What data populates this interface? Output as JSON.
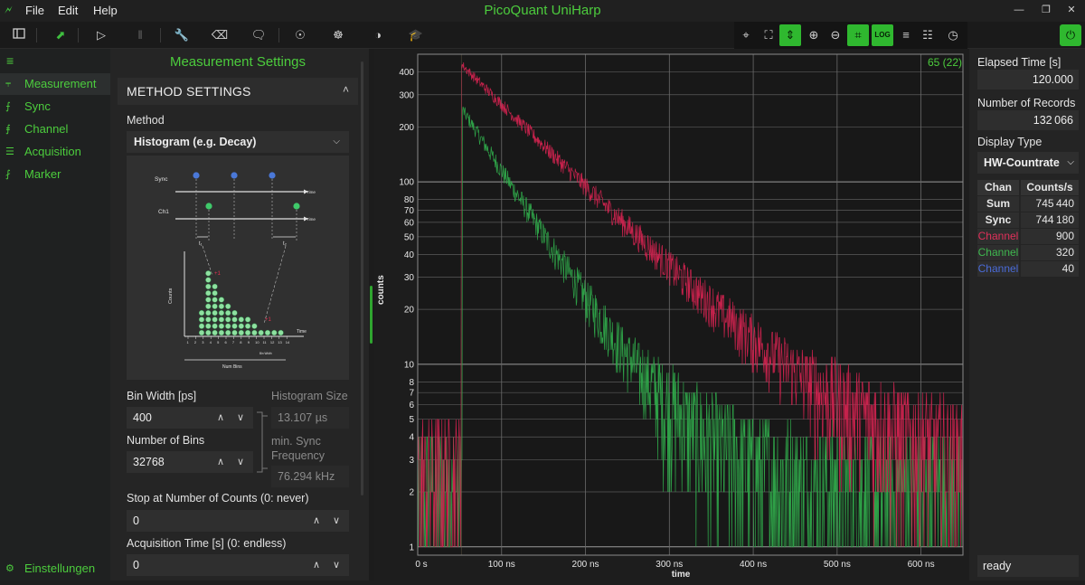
{
  "app": {
    "title": "PicoQuant UniHarp",
    "menu": [
      "File",
      "Edit",
      "Help"
    ],
    "window_controls": [
      "minimize-icon",
      "restore-icon",
      "close-icon"
    ]
  },
  "toolbar": {
    "left_icons": [
      "sidebar-toggle-icon",
      "connect-icon",
      "play-icon",
      "pause-icon",
      "wrench-icon",
      "eraser-icon",
      "comment-icon",
      "bulb-icon",
      "bug-icon",
      "contrast-icon",
      "graduation-cap-icon"
    ],
    "right_icons": [
      "crosshair-icon",
      "fit-icon",
      "fit-height-icon",
      "zoom-in-icon",
      "zoom-out-icon",
      "crop-icon",
      "log-icon",
      "notes-icon",
      "clipboard-icon",
      "book-icon",
      "speedometer-icon"
    ],
    "log_label": "LOG",
    "accent": "#2fb82f"
  },
  "sidebar": {
    "items": [
      {
        "label": "Measurement",
        "icon": "decay-icon",
        "selected": true
      },
      {
        "label": "Sync",
        "icon": "sync-icon"
      },
      {
        "label": "Channel",
        "icon": "channel-icon"
      },
      {
        "label": "Acquisition",
        "icon": "acquisition-icon"
      },
      {
        "label": "Marker",
        "icon": "marker-icon"
      }
    ],
    "footer": "Einstellungen"
  },
  "settings": {
    "title": "Measurement Settings",
    "section": "METHOD SETTINGS",
    "method_label": "Method",
    "method_value": "Histogram (e.g. Decay)",
    "diagram": {
      "sync": "Sync",
      "ch1": "Ch1",
      "time": "Time",
      "t1": "t₁",
      "t2": "t₂",
      "counts": "Counts",
      "plus_one": "+1",
      "num_bins": "Num Bins",
      "bin_width": "Bin Width",
      "ticks": [
        "1",
        "2",
        "3",
        "4",
        "5",
        "6",
        "7",
        "8",
        "9",
        "10",
        "11",
        "12",
        "13",
        "14"
      ]
    },
    "bin_width_label": "Bin Width [ps]",
    "bin_width_value": "400",
    "histogram_size_label": "Histogram Size",
    "histogram_size_value": "13.107 µs",
    "num_bins_label": "Number of Bins",
    "num_bins_value": "32768",
    "min_sync_label": "min. Sync Frequency",
    "min_sync_value": "76.294 kHz",
    "stop_label": "Stop at Number of Counts (0: never)",
    "stop_value": "0",
    "acq_label": "Acquisition Time [s] (0: endless)",
    "acq_value": "0"
  },
  "chart_data": {
    "type": "line",
    "title": "",
    "xlabel": "time",
    "ylabel": "counts",
    "y_scale": "log",
    "xlim_ns": [
      0,
      650
    ],
    "ylim": [
      0.9,
      500
    ],
    "x_ticks": [
      "0 s",
      "100 ns",
      "200 ns",
      "300 ns",
      "400 ns",
      "500 ns",
      "600 ns"
    ],
    "y_ticks": [
      "1",
      "2",
      "3",
      "4",
      "5",
      "6",
      "7",
      "8",
      "10",
      "20",
      "30",
      "40",
      "50",
      "60",
      "70",
      "80",
      "100",
      "200",
      "300",
      "400"
    ],
    "corner_label": "65 (22)",
    "grid": true,
    "series": [
      {
        "color": "#d0234f",
        "background_level": 2.5,
        "peak_time_ns": 52,
        "peak_counts": 440,
        "decay_tau_ns": 95,
        "points_t_ns": [
          52,
          100,
          150,
          200,
          250,
          300,
          350,
          400,
          450,
          500,
          600,
          650
        ],
        "points_counts": [
          420,
          200,
          110,
          60,
          35,
          20,
          13,
          8,
          6,
          5,
          4,
          3.5
        ]
      },
      {
        "color": "#2fa84a",
        "background_level": 2.0,
        "peak_time_ns": 53,
        "peak_counts": 250,
        "decay_tau_ns": 60,
        "points_t_ns": [
          53,
          100,
          150,
          200,
          250,
          300,
          350,
          400,
          500,
          650
        ],
        "points_counts": [
          240,
          110,
          45,
          18,
          8,
          4,
          3,
          2.5,
          2.5,
          2.5
        ]
      }
    ]
  },
  "right": {
    "elapsed_label": "Elapsed Time [s]",
    "elapsed_value": "120.000",
    "records_label": "Number of Records",
    "records_value": "132 066",
    "display_label": "Display Type",
    "display_value": "HW-Countrate",
    "table_head": [
      "Chan",
      "Counts/s"
    ],
    "rows": [
      {
        "chan": "Sum",
        "value": "745 440",
        "color": "#e6e6e6"
      },
      {
        "chan": "Sync",
        "value": "744 180",
        "color": "#e6e6e6"
      },
      {
        "chan": "Channel",
        "value": "900",
        "color": "#e0305a"
      },
      {
        "chan": "Channel",
        "value": "320",
        "color": "#3fb84f"
      },
      {
        "chan": "Channel",
        "value": "40",
        "color": "#4a6bd8"
      }
    ],
    "status": "ready"
  }
}
